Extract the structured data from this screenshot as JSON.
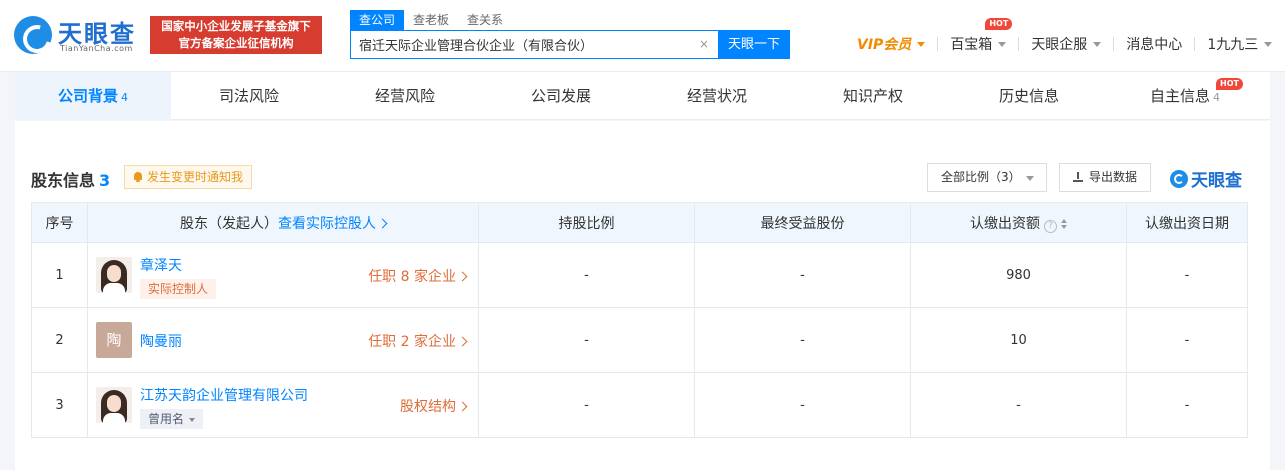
{
  "header": {
    "logo_text": "天眼查",
    "logo_sub": "TianYanCha.com",
    "banner_line1": "国家中小企业发展子基金旗下",
    "banner_line2": "官方备案企业征信机构",
    "search_tabs": [
      "查公司",
      "查老板",
      "查关系"
    ],
    "search_value": "宿迁天际企业管理合伙企业（有限合伙）",
    "search_button": "天眼一下",
    "clear_icon": "×",
    "nav": {
      "vip": "VIP会员",
      "toolbox": "百宝箱",
      "enterprise": "天眼企服",
      "messages": "消息中心",
      "user": "1九九三"
    },
    "hot_badge": "HOT"
  },
  "tabs": [
    {
      "label": "公司背景",
      "count": "4"
    },
    {
      "label": "司法风险"
    },
    {
      "label": "经营风险"
    },
    {
      "label": "公司发展"
    },
    {
      "label": "经营状况"
    },
    {
      "label": "知识产权"
    },
    {
      "label": "历史信息"
    },
    {
      "label": "自主信息",
      "count": "4",
      "hot": "HOT"
    }
  ],
  "section": {
    "title": "股东信息",
    "count": "3",
    "notify": "发生变更时通知我",
    "ratio_select": "全部比例（3）",
    "export": "导出数据",
    "watermark": "天眼查"
  },
  "table": {
    "headers": {
      "index": "序号",
      "shareholder": "股东（发起人）",
      "shareholder_link": "查看实际控股人",
      "ratio": "持股比例",
      "benefit": "最终受益股份",
      "subscribed": "认缴出资额",
      "help": "?",
      "date": "认缴出资日期"
    },
    "rows": [
      {
        "index": "1",
        "name": "章泽天",
        "tag": "实际控制人",
        "link": "任职 8 家企业",
        "ratio": "-",
        "benefit": "-",
        "subscribed": "980",
        "date": "-"
      },
      {
        "index": "2",
        "name": "陶曼丽",
        "avatar_letter": "陶",
        "link": "任职 2 家企业",
        "ratio": "-",
        "benefit": "-",
        "subscribed": "10",
        "date": "-"
      },
      {
        "index": "3",
        "name": "江苏天韵企业管理有限公司",
        "tag": "曾用名",
        "link": "股权结构",
        "ratio": "-",
        "benefit": "-",
        "subscribed": "-",
        "date": "-"
      }
    ]
  },
  "colors": {
    "brand_blue": "#0084ff",
    "vip_orange": "#f08c00",
    "hot_red": "#f0473a",
    "banner_red": "#d63c2f",
    "link_orange": "#e06c3a"
  },
  "icons": [
    "logo-icon",
    "clear-icon",
    "caret-down-icon",
    "bell-icon",
    "export-icon",
    "chevron-right-icon",
    "help-icon",
    "sort-icon"
  ]
}
